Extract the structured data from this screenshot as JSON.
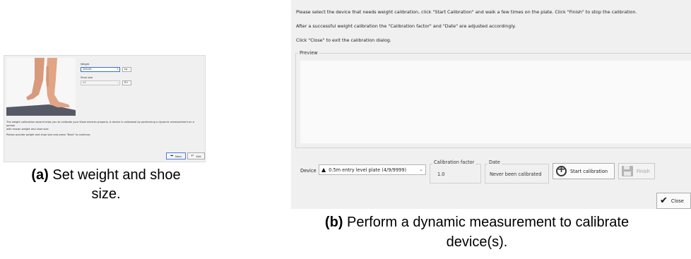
{
  "panel_a": {
    "weight_label": "Weight",
    "weight_value": "100.00",
    "weight_unit": "kg",
    "shoe_size_label": "Shoe size",
    "shoe_size_value": "43",
    "shoe_size_system": "EU",
    "description_line1": "The weight calibration wizard helps you to calibrate your Kiosk devices properly. A device is calibrated by performing a dynamic measurement on a person",
    "description_line2": "with known weight and shoe size.",
    "description_line3": "Please provide weight and shoe size and press \"Next\" to continue.",
    "next_label": "Next",
    "exit_label": "Exit"
  },
  "caption_a": {
    "tag": "(a)",
    "line1": "Set weight and shoe",
    "line2": "size."
  },
  "panel_b": {
    "instruction1": "Please select the device that needs weight calibration, click \"Start Calibration\" and walk a few times on the plate. Click \"Finish\" to stop the calibration.",
    "instruction2": "After a successful weight calibration the \"Calibration factor\" and \"Date\" are adjusted accordingly.",
    "instruction3": "Click \"Close\" to exit the calibration dialog.",
    "preview_label": "Preview",
    "device_label": "Device",
    "device_value": "0.5m entry level plate (4/9/9999)",
    "calibration_factor_label": "Calibration factor",
    "calibration_factor_value": "1.0",
    "date_label": "Date",
    "date_value": "Never been calibrated",
    "start_label": "Start calibration",
    "finish_label": "Finish",
    "close_label": "Close"
  },
  "caption_b": {
    "tag": "(b)",
    "line1": "Perform a dynamic measurement to calibrate",
    "line2": "device(s)."
  },
  "icons": {
    "next": "arrow-right-icon",
    "exit": "return-arrow-icon",
    "device_status": "warning-triangle-icon",
    "start": "crosshair-circle-icon",
    "finish": "floppy-disk-icon",
    "close": "checkmark-icon"
  }
}
